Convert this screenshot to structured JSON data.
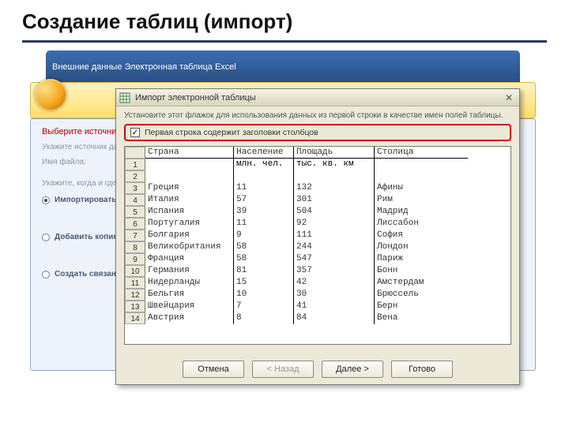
{
  "slide": {
    "title": "Создание таблиц (импорт)"
  },
  "back_window": {
    "title": "Внешние данные   Электронная таблица Excel"
  },
  "behind_dialog": {
    "choose_label": "Выберите источник и место назначения данных",
    "source_hint": "Укажите источник данных.",
    "filename_label": "Имя файла:",
    "when_hint": "Укажите, когда и где сохранять данные в текущей базе данных.",
    "opt_import": "Импортировать данные источника в новую таблицу в текущей базе данных.",
    "opt_append": "Добавить копию записей в конец таблицы:",
    "opt_link": "Создать связанную таблицу для связи с источником данных."
  },
  "front_dialog": {
    "title": "Импорт электронной таблицы",
    "hint": "Установите этот флажок для использования данных из первой строки в качестве имен полей таблицы.",
    "checkbox_label": "Первая строка содержит заголовки столбцов",
    "columns": [
      "Страна",
      "Население",
      "Площадь",
      "Столица"
    ],
    "subheader": [
      "",
      "млн. чел.",
      "тыс. кв. км",
      ""
    ],
    "rows": [
      {
        "n": "1",
        "c": [
          "",
          "",
          "",
          ""
        ]
      },
      {
        "n": "2",
        "c": [
          "",
          "",
          "",
          ""
        ]
      },
      {
        "n": "3",
        "c": [
          "Греция",
          "11",
          "132",
          "Афины"
        ]
      },
      {
        "n": "4",
        "c": [
          "Италия",
          "57",
          "301",
          "Рим"
        ]
      },
      {
        "n": "5",
        "c": [
          "Испания",
          "39",
          "504",
          "Мадрид"
        ]
      },
      {
        "n": "6",
        "c": [
          "Португалия",
          "11",
          "92",
          "Лиссабон"
        ]
      },
      {
        "n": "7",
        "c": [
          "Болгария",
          "9",
          "111",
          "София"
        ]
      },
      {
        "n": "8",
        "c": [
          "Великобритания",
          "58",
          "244",
          "Лондон"
        ]
      },
      {
        "n": "9",
        "c": [
          "Франция",
          "58",
          "547",
          "Париж"
        ]
      },
      {
        "n": "10",
        "c": [
          "Германия",
          "81",
          "357",
          "Бонн"
        ]
      },
      {
        "n": "11",
        "c": [
          "Нидерланды",
          "15",
          "42",
          "Амстердам"
        ]
      },
      {
        "n": "12",
        "c": [
          "Бельгия",
          "10",
          "30",
          "Брюссель"
        ]
      },
      {
        "n": "13",
        "c": [
          "Швейцария",
          "7",
          "41",
          "Берн"
        ]
      },
      {
        "n": "14",
        "c": [
          "Австрия",
          "8",
          "84",
          "Вена"
        ]
      }
    ],
    "buttons": {
      "cancel": "Отмена",
      "back": "< Назад",
      "next": "Далее >",
      "finish": "Готово"
    }
  }
}
